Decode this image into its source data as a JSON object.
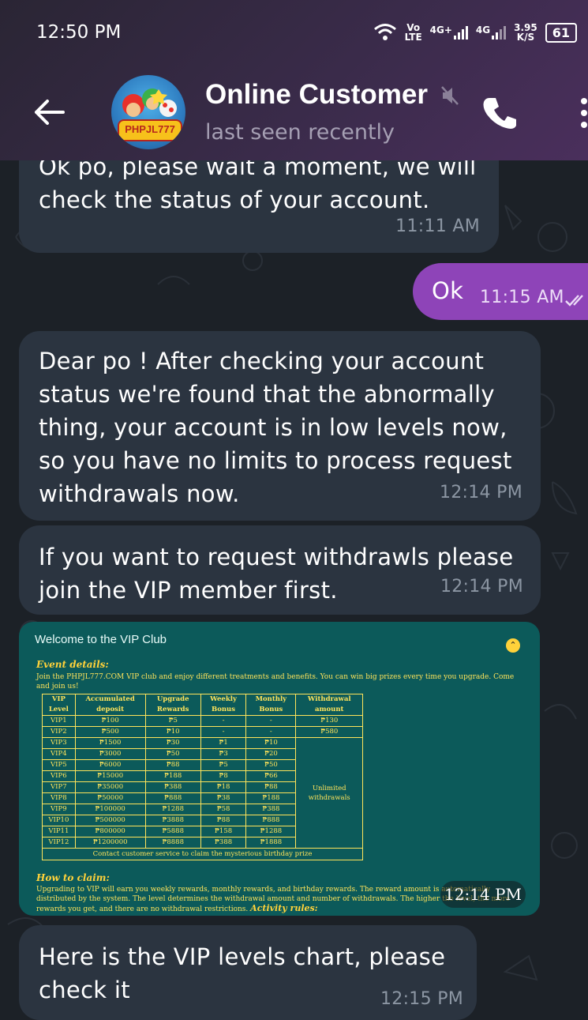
{
  "status_bar": {
    "time": "12:50 PM",
    "net_top": "Vo",
    "net_bottom": "LTE",
    "sig1": "4G+",
    "sig2": "4G",
    "speed_top": "3.95",
    "speed_bottom": "K/S",
    "battery": "61"
  },
  "header": {
    "title": "Online Customer",
    "subtitle": "last seen recently",
    "avatar_text": "PHPJL777"
  },
  "messages": [
    {
      "text": "Ok po, please wait a moment, we will check the status of your account.",
      "time": "11:11 AM"
    },
    {
      "text": "Ok",
      "time": "11:15 AM"
    },
    {
      "text": "Dear po ! After checking your account status we're found that the abnormally thing, your account is in low levels now, so you have no limits to process request withdrawals now.",
      "time": "12:14 PM"
    },
    {
      "text": "If you want to request withdrawls please join the VIP member first.",
      "time": "12:14 PM"
    },
    {
      "text": "Here is the VIP levels chart, please check it",
      "time": "12:15 PM"
    }
  ],
  "vip_image": {
    "time": "12:14 PM",
    "title": "Welcome to the VIP Club",
    "event_heading": "Event details:",
    "event_text": "Join the PHPJL777.COM VIP club and enjoy different treatments and benefits. You can win big prizes every time you upgrade. Come and join us!",
    "table_headers": [
      "VIP Level",
      "Accumulated deposit",
      "Upgrade Rewards",
      "Weekly Bonus",
      "Monthly Bonus",
      "Withdrawal amount"
    ],
    "rows": [
      [
        "VIP1",
        "₱100",
        "₱5",
        "-",
        "-",
        "₱130"
      ],
      [
        "VIP2",
        "₱500",
        "₱10",
        "-",
        "-",
        "₱580"
      ],
      [
        "VIP3",
        "₱1500",
        "₱30",
        "₱1",
        "₱10"
      ],
      [
        "VIP4",
        "₱3000",
        "₱50",
        "₱3",
        "₱20"
      ],
      [
        "VIP5",
        "₱6000",
        "₱88",
        "₱5",
        "₱50"
      ],
      [
        "VIP6",
        "₱15000",
        "₱188",
        "₱8",
        "₱66"
      ],
      [
        "VIP7",
        "₱35000",
        "₱388",
        "₱18",
        "₱88"
      ],
      [
        "VIP8",
        "₱50000",
        "₱888",
        "₱38",
        "₱188"
      ],
      [
        "VIP9",
        "₱100000",
        "₱1288",
        "₱58",
        "₱388"
      ],
      [
        "VIP10",
        "₱500000",
        "₱3888",
        "₱88",
        "₱888"
      ],
      [
        "VIP11",
        "₱800000",
        "₱5888",
        "₱158",
        "₱1288"
      ],
      [
        "VIP12",
        "₱1200000",
        "₱8888",
        "₱388",
        "₱1888"
      ]
    ],
    "unlimited": "Unlimited withdrawals",
    "footer_note": "Contact customer service to claim the mysterious birthday prize",
    "claim_heading": "How to claim:",
    "claim_text": "Upgrading to VIP will earn you weekly rewards, monthly rewards, and birthday rewards. The reward amount is automatically distributed by the system. The level determines the withdrawal amount and number of withdrawals. The higher the level, the more rewards you get, and there are no withdrawal restrictions.",
    "activity_heading": "Activity rules:"
  }
}
